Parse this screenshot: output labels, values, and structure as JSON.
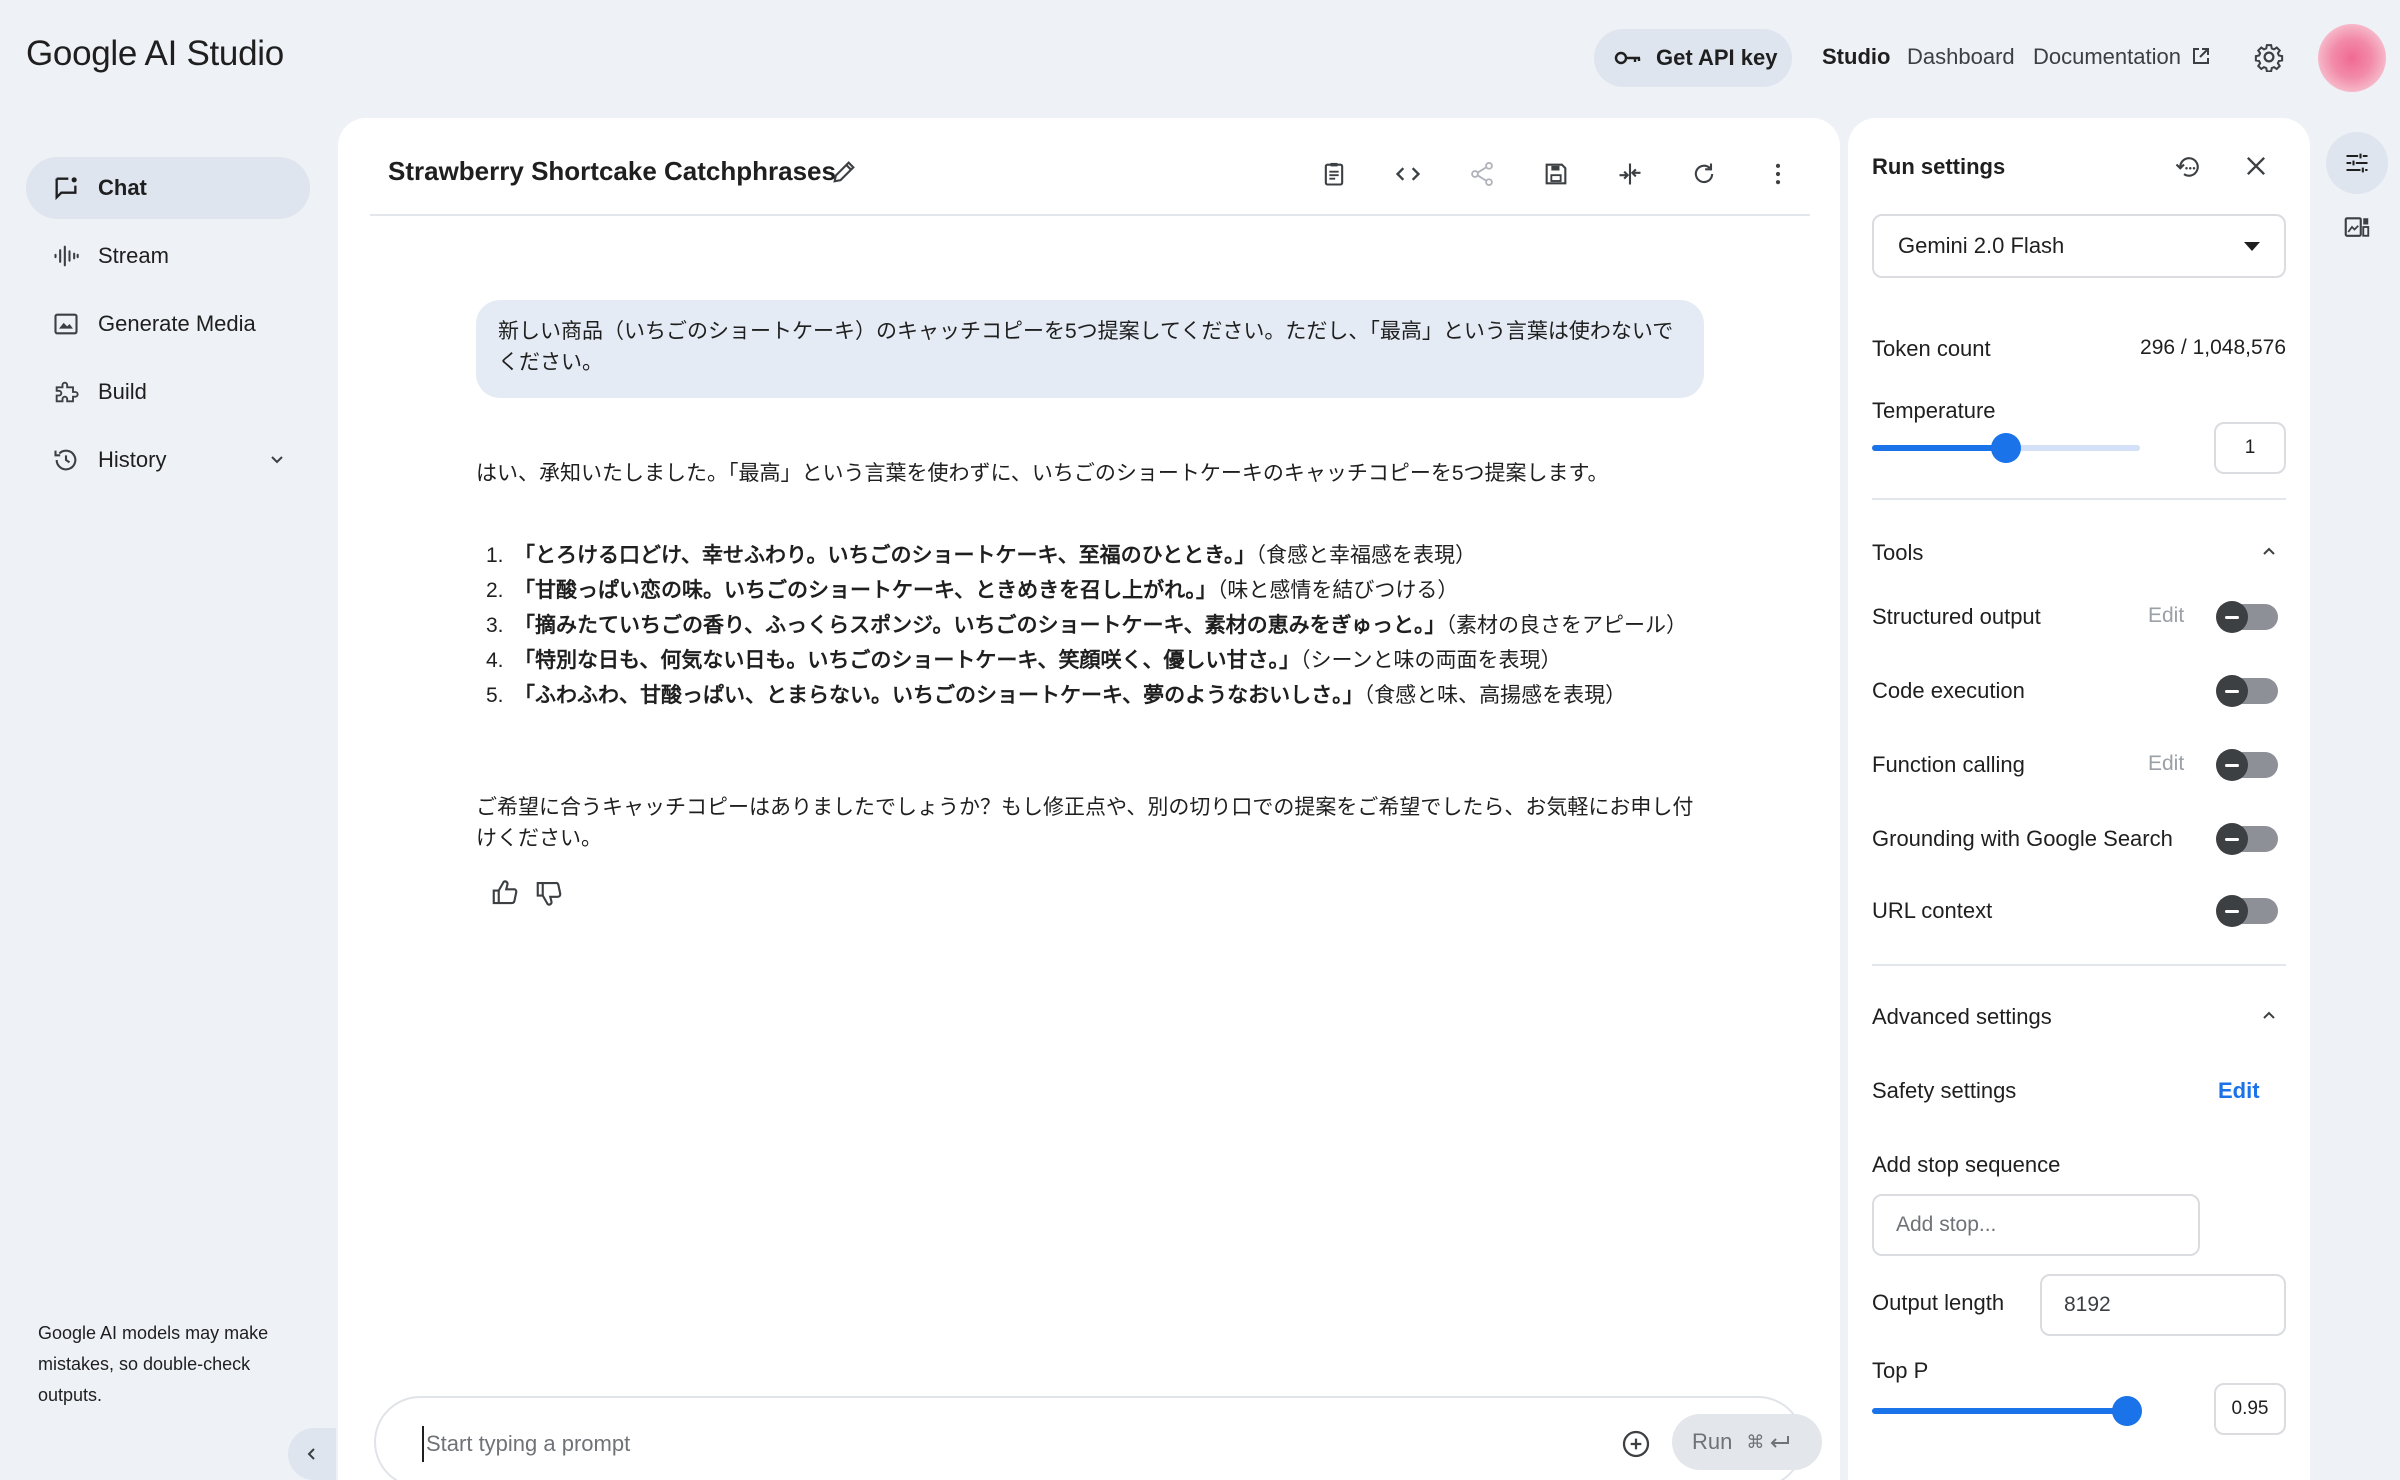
{
  "app": {
    "logo": "Google AI Studio"
  },
  "topbar": {
    "api_key_label": "Get API key",
    "links": [
      "Studio",
      "Dashboard",
      "Documentation"
    ]
  },
  "sidebar": {
    "items": [
      {
        "label": "Chat",
        "icon": "chat-icon"
      },
      {
        "label": "Stream",
        "icon": "stream-icon"
      },
      {
        "label": "Generate Media",
        "icon": "image-icon"
      },
      {
        "label": "Build",
        "icon": "puzzle-icon"
      },
      {
        "label": "History",
        "icon": "history-icon"
      }
    ],
    "disclaimer": "Google AI models may make mistakes, so double-check outputs."
  },
  "chat": {
    "title": "Strawberry Shortcake Catchphrases",
    "user_message": "新しい商品（いちごのショートケーキ）のキャッチコピーを5つ提案してください。ただし、「最高」という言葉は使わないでください。",
    "reply_intro": "はい、承知いたしました。「最高」という言葉を使わずに、いちごのショートケーキのキャッチコピーを5つ提案します。",
    "reply_items": [
      {
        "num": "1.",
        "bold": "「とろける口どけ、幸せふわり。いちごのショートケーキ、至福のひととき。」",
        "note": "（食感と幸福感を表現）"
      },
      {
        "num": "2.",
        "bold": "「甘酸っぱい恋の味。いちごのショートケーキ、ときめきを召し上がれ。」",
        "note": "（味と感情を結びつける）"
      },
      {
        "num": "3.",
        "bold": "「摘みたていちごの香り、ふっくらスポンジ。いちごのショートケーキ、素材の恵みをぎゅっと。」",
        "note": "（素材の良さをアピール）"
      },
      {
        "num": "4.",
        "bold": "「特別な日も、何気ない日も。いちごのショートケーキ、笑顔咲く、優しい甘さ。」",
        "note": "（シーンと味の両面を表現）"
      },
      {
        "num": "5.",
        "bold": "「ふわふわ、甘酸っぱい、とまらない。いちごのショートケーキ、夢のようなおいしさ。」",
        "note": "（食感と味、高揚感を表現）"
      }
    ],
    "reply_outro": "ご希望に合うキャッチコピーはありましたでしょうか？もし修正点や、別の切り口での提案をご希望でしたら、お気軽にお申し付けください。",
    "prompt_placeholder": "Start typing a prompt",
    "run_label": "Run",
    "run_shortcut": "⌘"
  },
  "settings": {
    "title": "Run settings",
    "model": "Gemini 2.0 Flash",
    "token_count_label": "Token count",
    "token_count_value": "296 / 1,048,576",
    "temperature_label": "Temperature",
    "temperature_value": "1",
    "temperature_fraction": 0.5,
    "tools_label": "Tools",
    "tools": [
      {
        "label": "Structured output",
        "edit": "Edit",
        "enabled": false
      },
      {
        "label": "Code execution",
        "edit": "",
        "enabled": false
      },
      {
        "label": "Function calling",
        "edit": "Edit",
        "enabled": false
      },
      {
        "label": "Grounding with Google Search",
        "edit": "",
        "enabled": false
      },
      {
        "label": "URL context",
        "edit": "",
        "enabled": false
      }
    ],
    "advanced_label": "Advanced settings",
    "safety_label": "Safety settings",
    "safety_edit": "Edit",
    "stop_label": "Add stop sequence",
    "stop_placeholder": "Add stop...",
    "output_length_label": "Output length",
    "output_length_value": "8192",
    "top_p_label": "Top P",
    "top_p_value": "0.95",
    "top_p_fraction": 0.95
  },
  "colors": {
    "accent": "#1a73e8",
    "bubble": "#e5ebf4",
    "background": "#eef1f6"
  }
}
